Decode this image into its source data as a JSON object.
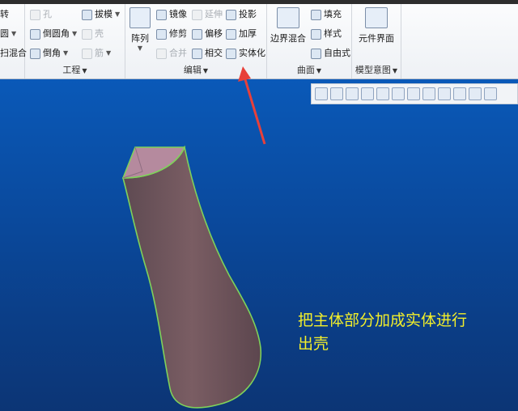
{
  "ribbon": {
    "group_gongcheng": {
      "edge_labels": [
        "转",
        "圆",
        "扫混合"
      ],
      "items": [
        "孔",
        "倒圆角",
        "倒角",
        "拔模",
        "壳",
        "筋"
      ],
      "label": "工程"
    },
    "group_bianji": {
      "array_label": "阵列",
      "items": [
        "镜像",
        "修剪",
        "合并",
        "延伸",
        "偏移",
        "相交",
        "投影",
        "加厚",
        "实体化"
      ],
      "label": "编辑"
    },
    "group_qumian": {
      "boundary_label": "边界混合",
      "items": [
        "填充",
        "样式",
        "自由式"
      ],
      "label": "曲面"
    },
    "group_moxing": {
      "component_label": "元件界面",
      "label": "模型意图"
    }
  },
  "caption": {
    "line1": "把主体部分加成实体进行",
    "line2": "出壳"
  },
  "colors": {
    "caption": "#f3ef2a",
    "arrow": "#e8403a",
    "model_edge": "#7fd25a",
    "model_fill": "#7a5a60"
  }
}
